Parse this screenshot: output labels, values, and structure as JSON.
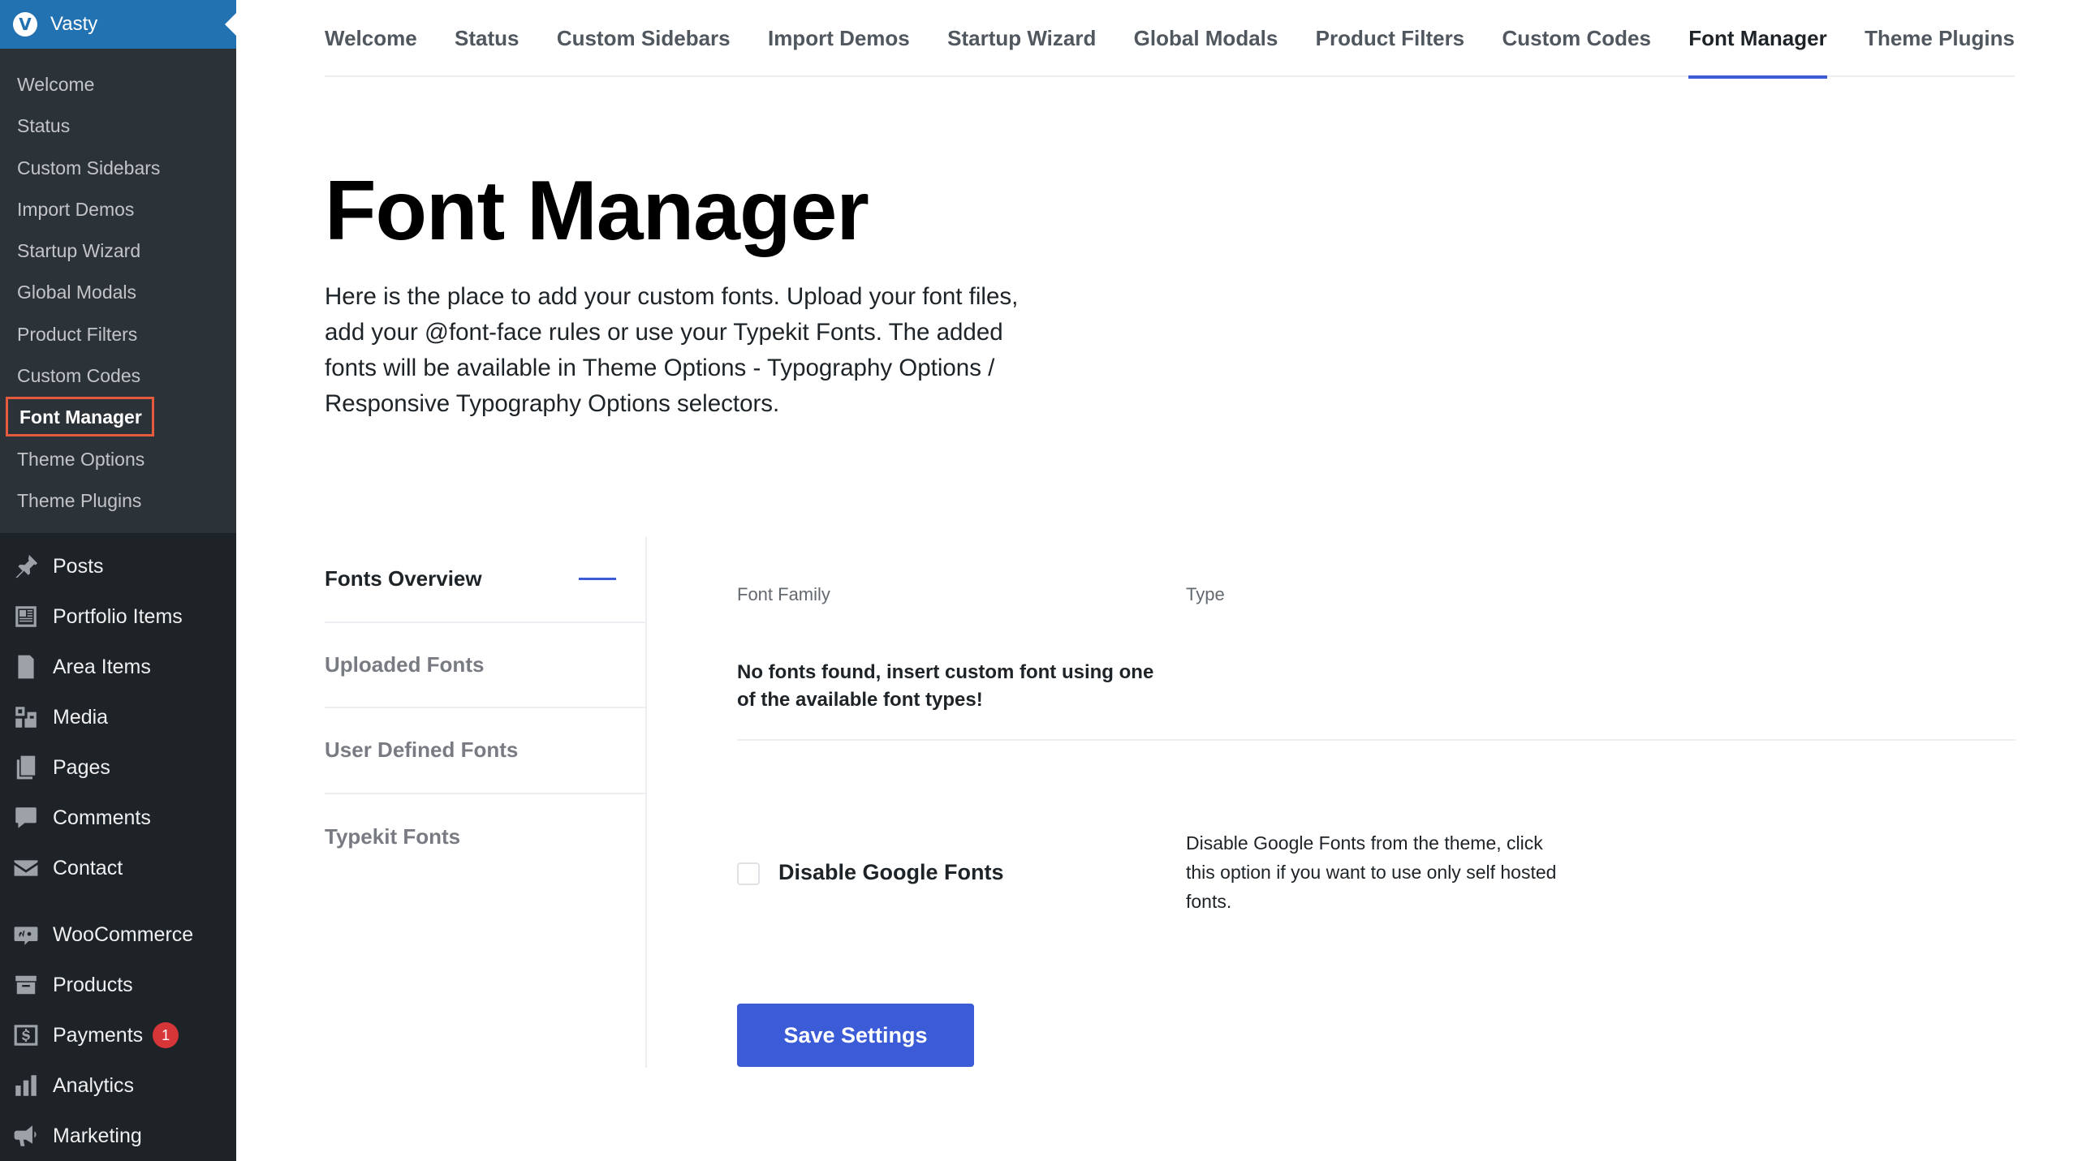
{
  "brand": {
    "logo_letter": "V",
    "label": "Vasty"
  },
  "submenu": [
    {
      "label": "Welcome"
    },
    {
      "label": "Status"
    },
    {
      "label": "Custom Sidebars"
    },
    {
      "label": "Import Demos"
    },
    {
      "label": "Startup Wizard"
    },
    {
      "label": "Global Modals"
    },
    {
      "label": "Product Filters"
    },
    {
      "label": "Custom Codes"
    },
    {
      "label": "Font Manager",
      "active": true
    },
    {
      "label": "Theme Options"
    },
    {
      "label": "Theme Plugins"
    }
  ],
  "mainmenu": [
    {
      "label": "Posts",
      "icon": "pushpin-icon"
    },
    {
      "label": "Portfolio Items",
      "icon": "portfolio-icon"
    },
    {
      "label": "Area Items",
      "icon": "document-icon"
    },
    {
      "label": "Media",
      "icon": "media-icon"
    },
    {
      "label": "Pages",
      "icon": "pages-icon"
    },
    {
      "label": "Comments",
      "icon": "comment-icon"
    },
    {
      "label": "Contact",
      "icon": "envelope-icon"
    },
    {
      "label": "WooCommerce",
      "icon": "woocommerce-icon"
    },
    {
      "label": "Products",
      "icon": "archive-box-icon"
    },
    {
      "label": "Payments",
      "icon": "dollar-icon",
      "badge": "1"
    },
    {
      "label": "Analytics",
      "icon": "bar-chart-icon"
    },
    {
      "label": "Marketing",
      "icon": "megaphone-icon"
    }
  ],
  "tabs": [
    {
      "label": "Welcome"
    },
    {
      "label": "Status"
    },
    {
      "label": "Custom Sidebars"
    },
    {
      "label": "Import Demos"
    },
    {
      "label": "Startup Wizard"
    },
    {
      "label": "Global Modals"
    },
    {
      "label": "Product Filters"
    },
    {
      "label": "Custom Codes"
    },
    {
      "label": "Font Manager",
      "active": true
    },
    {
      "label": "Theme Plugins"
    }
  ],
  "page": {
    "title": "Font Manager",
    "description": "Here is the place to add your custom fonts. Upload your font files, add your @font-face rules or use your Typekit Fonts. The added fonts will be available in Theme Options - Typography Options / Responsive Typography Options selectors."
  },
  "vtabs": [
    {
      "label": "Fonts Overview",
      "active": true
    },
    {
      "label": "Uploaded Fonts"
    },
    {
      "label": "User Defined Fonts"
    },
    {
      "label": "Typekit Fonts"
    }
  ],
  "table": {
    "col_font_family": "Font Family",
    "col_type": "Type",
    "empty_message": "No fonts found, insert custom font using one of the available font types!"
  },
  "option": {
    "label": "Disable Google Fonts",
    "checked": false,
    "help": "Disable Google Fonts from the theme, click this option if you want to use only self hosted fonts."
  },
  "save_button": "Save Settings",
  "colors": {
    "sidebar_bg": "#1d2327",
    "submenu_bg": "#2c3338",
    "brand_bg": "#2271b1",
    "accent": "#3c5bd6",
    "highlight_border": "#e65a3e",
    "badge": "#d63638"
  }
}
